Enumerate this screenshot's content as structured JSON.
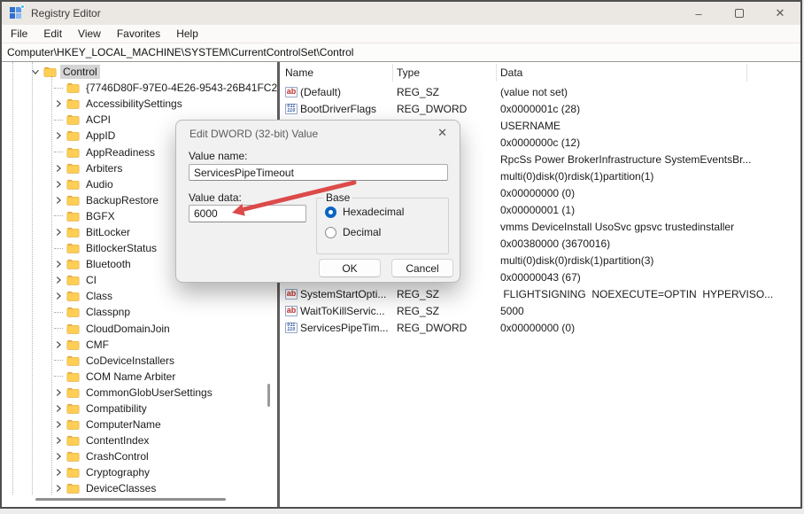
{
  "window": {
    "title": "Registry Editor",
    "controls": {
      "minimize": "–",
      "maximize": "maximize",
      "close": "✕"
    }
  },
  "menu": {
    "items": [
      "File",
      "Edit",
      "View",
      "Favorites",
      "Help"
    ]
  },
  "address": {
    "path": "Computer\\HKEY_LOCAL_MACHINE\\SYSTEM\\CurrentControlSet\\Control"
  },
  "tree": {
    "items": [
      {
        "label": "Control",
        "state": "expanded",
        "selected": true,
        "level": 0
      },
      {
        "label": "{7746D80F-97E0-4E26-9543-26B41FC2",
        "state": "leaf",
        "level": 1
      },
      {
        "label": "AccessibilitySettings",
        "state": "collapsed",
        "level": 1
      },
      {
        "label": "ACPI",
        "state": "leaf",
        "level": 1
      },
      {
        "label": "AppID",
        "state": "collapsed",
        "level": 1
      },
      {
        "label": "AppReadiness",
        "state": "leaf",
        "level": 1
      },
      {
        "label": "Arbiters",
        "state": "collapsed",
        "level": 1
      },
      {
        "label": "Audio",
        "state": "collapsed",
        "level": 1
      },
      {
        "label": "BackupRestore",
        "state": "collapsed",
        "level": 1
      },
      {
        "label": "BGFX",
        "state": "leaf",
        "level": 1
      },
      {
        "label": "BitLocker",
        "state": "collapsed",
        "level": 1
      },
      {
        "label": "BitlockerStatus",
        "state": "leaf",
        "level": 1
      },
      {
        "label": "Bluetooth",
        "state": "collapsed",
        "level": 1
      },
      {
        "label": "CI",
        "state": "collapsed",
        "level": 1
      },
      {
        "label": "Class",
        "state": "collapsed",
        "level": 1
      },
      {
        "label": "Classpnp",
        "state": "leaf",
        "level": 1
      },
      {
        "label": "CloudDomainJoin",
        "state": "leaf",
        "level": 1
      },
      {
        "label": "CMF",
        "state": "collapsed",
        "level": 1
      },
      {
        "label": "CoDeviceInstallers",
        "state": "leaf",
        "level": 1
      },
      {
        "label": "COM Name Arbiter",
        "state": "leaf",
        "level": 1
      },
      {
        "label": "CommonGlobUserSettings",
        "state": "collapsed",
        "level": 1
      },
      {
        "label": "Compatibility",
        "state": "collapsed",
        "level": 1
      },
      {
        "label": "ComputerName",
        "state": "collapsed",
        "level": 1
      },
      {
        "label": "ContentIndex",
        "state": "collapsed",
        "level": 1
      },
      {
        "label": "CrashControl",
        "state": "collapsed",
        "level": 1
      },
      {
        "label": "Cryptography",
        "state": "collapsed",
        "level": 1
      },
      {
        "label": "DeviceClasses",
        "state": "collapsed",
        "level": 1
      }
    ]
  },
  "list": {
    "columns": [
      "Name",
      "Type",
      "Data"
    ],
    "rows": [
      {
        "name": "(Default)",
        "type": "REG_SZ",
        "data": "(value not set)",
        "icon": "string"
      },
      {
        "name": "BootDriverFlags",
        "type": "REG_DWORD",
        "data": "0x0000001c (28)",
        "icon": "dword"
      },
      {
        "name": "",
        "type": "",
        "data": "USERNAME",
        "icon": ""
      },
      {
        "name": "",
        "type": "",
        "data": "0x0000000c (12)",
        "icon": ""
      },
      {
        "name": "",
        "type": "",
        "data": "RpcSs Power BrokerInfrastructure SystemEventsBr...",
        "icon": ""
      },
      {
        "name": "",
        "type": "",
        "data": "multi(0)disk(0)rdisk(1)partition(1)",
        "icon": ""
      },
      {
        "name": "",
        "type": "",
        "data": "0x00000000 (0)",
        "icon": ""
      },
      {
        "name": "",
        "type": "",
        "data": "0x00000001 (1)",
        "icon": ""
      },
      {
        "name": "",
        "type": "",
        "data": "vmms DeviceInstall UsoSvc gpsvc trustedinstaller",
        "icon": ""
      },
      {
        "name": "",
        "type": "",
        "data": "0x00380000 (3670016)",
        "icon": ""
      },
      {
        "name": "",
        "type": "",
        "data": "multi(0)disk(0)rdisk(1)partition(3)",
        "icon": ""
      },
      {
        "name": "",
        "type": "",
        "data": "0x00000043 (67)",
        "icon": ""
      },
      {
        "name": "SystemStartOpti...",
        "type": "REG_SZ",
        "data": " FLIGHTSIGNING  NOEXECUTE=OPTIN  HYPERVISO...",
        "icon": "string"
      },
      {
        "name": "WaitToKillServic...",
        "type": "REG_SZ",
        "data": "5000",
        "icon": "string"
      },
      {
        "name": "ServicesPipeTim...",
        "type": "REG_DWORD",
        "data": "0x00000000 (0)",
        "icon": "dword"
      }
    ]
  },
  "dialog": {
    "title": "Edit DWORD (32-bit) Value",
    "close": "✕",
    "value_name_label": "Value name:",
    "value_name": "ServicesPipeTimeout",
    "value_data_label": "Value data:",
    "value_data": "6000",
    "base_label": "Base",
    "options": [
      {
        "label": "Hexadecimal",
        "selected": true
      },
      {
        "label": "Decimal",
        "selected": false
      }
    ],
    "ok_label": "OK",
    "cancel_label": "Cancel"
  },
  "annotation": {
    "type": "red-arrow",
    "color": "#dc4a4a",
    "points_at": "value-data-field"
  },
  "colors": {
    "accent_blue": "#0b64c4",
    "folder_yellow": "#ffce54",
    "selection_gray": "#d4d4d4",
    "string_icon_red": "#c23131",
    "dword_icon_blue": "#2b4d9e",
    "titlebar": "#ebe7e2"
  }
}
